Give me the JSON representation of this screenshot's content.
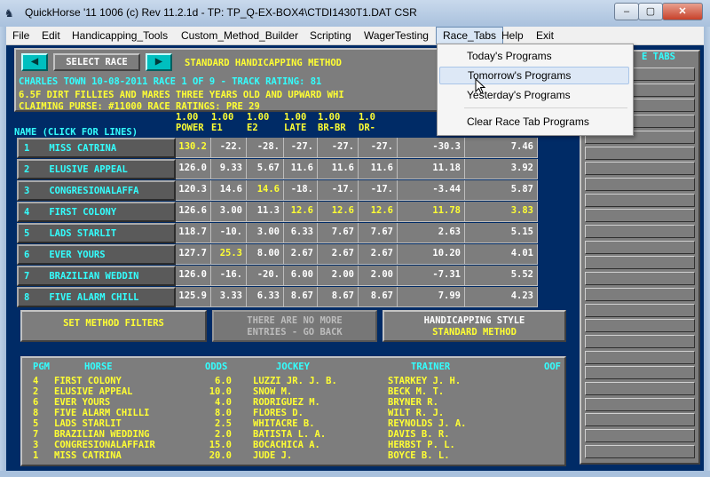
{
  "window": {
    "title": "QuickHorse '11 1006 (c) Rev 11.2.1d - TP: TP_Q-EX-BOX4\\CTDI1430T1.DAT CSR",
    "minimize_glyph": "‒",
    "maximize_glyph": "▢",
    "close_glyph": "✕"
  },
  "menu": {
    "items": [
      "File",
      "Edit",
      "Handicapping_Tools",
      "Custom_Method_Builder",
      "Scripting",
      "WagerTesting",
      "Race_Tabs",
      "Help",
      "Exit"
    ],
    "open_item": "Race_Tabs"
  },
  "dropdown": {
    "items": [
      "Today's Programs",
      "Tomorrow's Programs",
      "Yesterday's Programs",
      "Clear Race Tab Programs"
    ],
    "hovered": "Tomorrow's Programs"
  },
  "toolbar": {
    "prev_glyph": "◀",
    "select_race_label": "SELECT RACE",
    "next_glyph": "▶",
    "method_label": "STANDARD HANDICAPPING METHOD"
  },
  "race": {
    "line1": "CHARLES TOWN 10-08-2011 RACE 1 OF 9 - TRACK RATING: 81",
    "line2": "6.5F DIRT FILLIES AND MARES THREE YEARS OLD  AND UPWARD WHI",
    "line3": "CLAIMING PURSE: #11000  RACE RATINGS: PRE 29"
  },
  "grid": {
    "name_header": "NAME (CLICK FOR LINES)",
    "columns": [
      {
        "weight": "1.00",
        "label": "POWER"
      },
      {
        "weight": "1.00",
        "label": "E1"
      },
      {
        "weight": "1.00",
        "label": "E2"
      },
      {
        "weight": "1.00",
        "label": "LATE"
      },
      {
        "weight": "1.00",
        "label": "BR-BR"
      },
      {
        "weight": "1.0",
        "label": "DR-"
      },
      {
        "weight": "",
        "label": ""
      },
      {
        "weight": "",
        "label": ""
      }
    ],
    "rows": [
      {
        "pgm": "1",
        "name": "MISS CATRINA",
        "vals": [
          "130.2",
          "-22.",
          "-28.",
          "-27.",
          "-27.",
          "-27.",
          "-30.3",
          "7.46"
        ],
        "hl": [
          0
        ]
      },
      {
        "pgm": "2",
        "name": "ELUSIVE APPEAL",
        "vals": [
          "126.0",
          "9.33",
          "5.67",
          "11.6",
          "11.6",
          "11.6",
          "11.18",
          "3.92"
        ],
        "hl": []
      },
      {
        "pgm": "3",
        "name": "CONGRESIONALAFFA",
        "vals": [
          "120.3",
          "14.6",
          "14.6",
          "-18.",
          "-17.",
          "-17.",
          "-3.44",
          "5.87"
        ],
        "hl": [
          2
        ]
      },
      {
        "pgm": "4",
        "name": "FIRST COLONY",
        "vals": [
          "126.6",
          "3.00",
          "11.3",
          "12.6",
          "12.6",
          "12.6",
          "11.78",
          "3.83"
        ],
        "hl": [
          3,
          4,
          5,
          6,
          7
        ]
      },
      {
        "pgm": "5",
        "name": "LADS STARLIT",
        "vals": [
          "118.7",
          "-10.",
          "3.00",
          "6.33",
          "7.67",
          "7.67",
          "2.63",
          "5.15"
        ],
        "hl": []
      },
      {
        "pgm": "6",
        "name": "EVER YOURS",
        "vals": [
          "127.7",
          "25.3",
          "8.00",
          "2.67",
          "2.67",
          "2.67",
          "10.20",
          "4.01"
        ],
        "hl": [
          1
        ]
      },
      {
        "pgm": "7",
        "name": "BRAZILIAN WEDDIN",
        "vals": [
          "126.0",
          "-16.",
          "-20.",
          "6.00",
          "2.00",
          "2.00",
          "-7.31",
          "5.52"
        ],
        "hl": []
      },
      {
        "pgm": "8",
        "name": "FIVE ALARM CHILL",
        "vals": [
          "125.9",
          "3.33",
          "6.33",
          "8.67",
          "8.67",
          "8.67",
          "7.99",
          "4.23"
        ],
        "hl": []
      }
    ]
  },
  "buttons": {
    "filters": "SET METHOD FILTERS",
    "no_more_1": "THERE ARE NO MORE",
    "no_more_2": "ENTRIES - GO BACK",
    "style_1": "HANDICAPPING STYLE",
    "style_2": "STANDARD METHOD"
  },
  "entries": {
    "headers": {
      "pgm": "PGM",
      "horse": "HORSE",
      "odds": "ODDS",
      "jockey": "JOCKEY",
      "trainer": "TRAINER",
      "oof": "OOF"
    },
    "rows": [
      {
        "pgm": "4",
        "horse": "FIRST COLONY",
        "odds": "6.0",
        "jockey": "LUZZI JR. J. B.",
        "trainer": "STARKEY J. H."
      },
      {
        "pgm": "2",
        "horse": "ELUSIVE APPEAL",
        "odds": "10.0",
        "jockey": "SNOW M.",
        "trainer": "BECK M. T."
      },
      {
        "pgm": "6",
        "horse": "EVER YOURS",
        "odds": "4.0",
        "jockey": "RODRIGUEZ M.",
        "trainer": "BRYNER R."
      },
      {
        "pgm": "8",
        "horse": "FIVE ALARM CHILLI",
        "odds": "8.0",
        "jockey": "FLORES D.",
        "trainer": "WILT R. J."
      },
      {
        "pgm": "5",
        "horse": "LADS STARLIT",
        "odds": "2.5",
        "jockey": "WHITACRE B.",
        "trainer": "REYNOLDS J. A."
      },
      {
        "pgm": "7",
        "horse": "BRAZILIAN WEDDING",
        "odds": "2.0",
        "jockey": "BATISTA L. A.",
        "trainer": "DAVIS B. R."
      },
      {
        "pgm": "3",
        "horse": "CONGRESIONALAFFAIR",
        "odds": "15.0",
        "jockey": "BOCACHICA A.",
        "trainer": "HERBST P. L."
      },
      {
        "pgm": "1",
        "horse": "MISS CATRINA",
        "odds": "20.0",
        "jockey": "JUDE J.",
        "trainer": "BOYCE B. L."
      }
    ]
  },
  "right_panel": {
    "title": "E TABS",
    "tab_count": 25
  },
  "colors": {
    "yellow": "#ffff33",
    "cyan": "#33ffff",
    "panel_gray": "#7d7d7d",
    "background_blue": "#002b66"
  }
}
